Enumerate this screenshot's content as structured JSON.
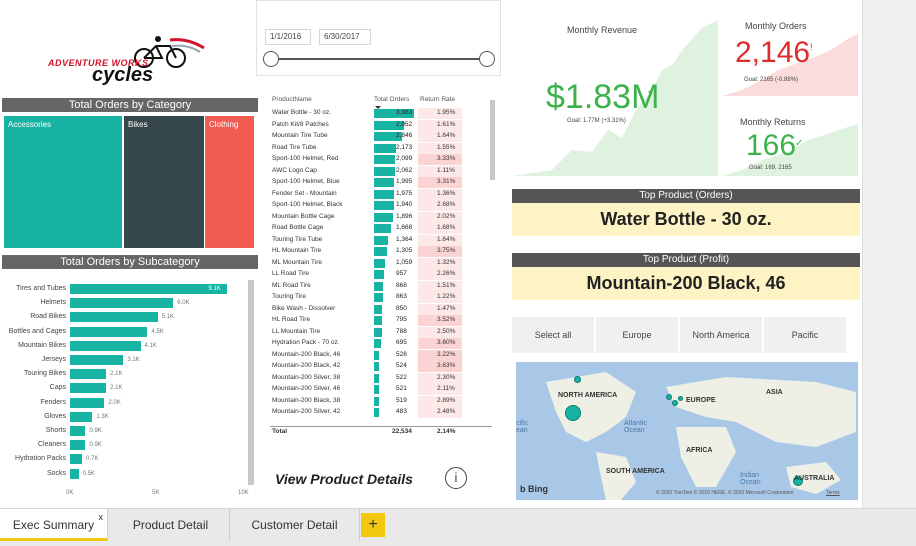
{
  "logo": {
    "line1": "ADVENTURE WORKS",
    "line2": "cycles"
  },
  "date_slicer": {
    "start": "1/1/2016",
    "end": "6/30/2017"
  },
  "category_chart": {
    "title": "Total Orders by Category",
    "tiles": [
      {
        "label": "Accessories",
        "color": "#17b3a3"
      },
      {
        "label": "Bikes",
        "color": "#36474b"
      },
      {
        "label": "Clothing",
        "color": "#f15b52"
      }
    ]
  },
  "chart_data": {
    "type": "bar",
    "title": "Total Orders by Subcategory",
    "categories": [
      "Tires and Tubes",
      "Helmets",
      "Road Bikes",
      "Bottles and Cages",
      "Mountain Bikes",
      "Jerseys",
      "Touring Bikes",
      "Caps",
      "Fenders",
      "Gloves",
      "Shorts",
      "Cleaners",
      "Hydration Packs",
      "Socks"
    ],
    "values": [
      9.1,
      6.0,
      5.1,
      4.5,
      4.1,
      3.1,
      2.1,
      2.1,
      2.0,
      1.3,
      0.9,
      0.9,
      0.7,
      0.5
    ],
    "value_labels": [
      "9.1K",
      "6.0K",
      "5.1K",
      "4.5K",
      "4.1K",
      "3.1K",
      "2.1K",
      "2.1K",
      "2.0K",
      "1.3K",
      "0.9K",
      "0.9K",
      "0.7K",
      "0.5K"
    ],
    "xlim": [
      0,
      10
    ],
    "xticks": [
      "0K",
      "5K",
      "10K"
    ],
    "color": "#17b3a3"
  },
  "product_table": {
    "headers": [
      "ProductName",
      "Total Orders",
      "Return Rate"
    ],
    "rows": [
      [
        "Water Bottle - 30 oz.",
        "3,983",
        "1.95%"
      ],
      [
        "Patch Kit/8 Patches",
        "2,952",
        "1.61%"
      ],
      [
        "Mountain Tire Tube",
        "2,846",
        "1.64%"
      ],
      [
        "Road Tire Tube",
        "2,173",
        "1.55%"
      ],
      [
        "Sport-100 Helmet, Red",
        "2,099",
        "3.33%"
      ],
      [
        "AWC Logo Cap",
        "2,062",
        "1.11%"
      ],
      [
        "Sport-100 Helmet, Blue",
        "1,995",
        "3.31%"
      ],
      [
        "Fender Set - Mountain",
        "1,975",
        "1.36%"
      ],
      [
        "Sport-100 Helmet, Black",
        "1,940",
        "2.68%"
      ],
      [
        "Mountain Bottle Cage",
        "1,896",
        "2.02%"
      ],
      [
        "Road Bottle Cage",
        "1,668",
        "1.68%"
      ],
      [
        "Touring Tire Tube",
        "1,364",
        "1.64%"
      ],
      [
        "HL Mountain Tire",
        "1,305",
        "3.75%"
      ],
      [
        "ML Mountain Tire",
        "1,059",
        "1.32%"
      ],
      [
        "LL Road Tire",
        "957",
        "2.26%"
      ],
      [
        "ML Road Tire",
        "868",
        "1.51%"
      ],
      [
        "Touring Tire",
        "863",
        "1.22%"
      ],
      [
        "Bike Wash - Dissolver",
        "850",
        "1.47%"
      ],
      [
        "HL Road Tire",
        "795",
        "3.52%"
      ],
      [
        "LL Mountain Tire",
        "788",
        "2.50%"
      ],
      [
        "Hydration Pack - 70 oz.",
        "695",
        "3.60%"
      ],
      [
        "Mountain-200 Black, 46",
        "528",
        "3.22%"
      ],
      [
        "Mountain-200 Black, 42",
        "524",
        "3.63%"
      ],
      [
        "Mountain-200 Silver, 38",
        "522",
        "2.30%"
      ],
      [
        "Mountain-200 Silver, 46",
        "521",
        "2.11%"
      ],
      [
        "Mountain-200 Black, 38",
        "519",
        "2.89%"
      ],
      [
        "Mountain-200 Silver, 42",
        "483",
        "2.48%"
      ]
    ],
    "bar_fractions": [
      1.0,
      0.74,
      0.71,
      0.55,
      0.53,
      0.52,
      0.5,
      0.5,
      0.49,
      0.48,
      0.42,
      0.34,
      0.33,
      0.27,
      0.24,
      0.22,
      0.22,
      0.21,
      0.2,
      0.2,
      0.17,
      0.13,
      0.13,
      0.13,
      0.13,
      0.13,
      0.12
    ],
    "total_label": "Total",
    "total_orders": "22,534",
    "total_rate": "2.14%"
  },
  "details_link": "View Product Details",
  "kpis": {
    "revenue": {
      "label": "Monthly Revenue",
      "value": "$1.83M",
      "goal": "Goal: 1.77M (+3.31%)"
    },
    "orders": {
      "label": "Monthly Orders",
      "value": "2,146",
      "goal": "Goal: 2165 (-0.88%)"
    },
    "returns": {
      "label": "Monthly Returns",
      "value": "166",
      "goal": "Goal: 169, 2165"
    }
  },
  "top_orders": {
    "title": "Top Product (Orders)",
    "value": "Water Bottle - 30 oz."
  },
  "top_profit": {
    "title": "Top Product (Profit)",
    "value": "Mountain-200 Black, 46"
  },
  "regions": [
    "Select all",
    "Europe",
    "North America",
    "Pacific"
  ],
  "map": {
    "labels": {
      "na": "NORTH AMERICA",
      "eu": "EUROPE",
      "asia": "ASIA",
      "africa": "AFRICA",
      "sa": "SOUTH AMERICA",
      "au": "AUSTRALIA"
    },
    "oceans": {
      "atlantic": "Atlantic Ocean",
      "indian": "Indian Ocean",
      "pacific": "cific ean"
    },
    "bing": "Bing",
    "copyright": "© 2020 TomTom © 2020 HERE, © 2020 Microsoft Corporation",
    "terms": "Terms"
  },
  "tabs": [
    {
      "label": "Exec Summary",
      "close": "x"
    },
    {
      "label": "Product Detail"
    },
    {
      "label": "Customer Detail"
    }
  ],
  "add_tab": "+",
  "colors": {
    "teal": "#17b3a3",
    "green": "#3cb34a",
    "red": "#e02b2b",
    "gold": "#f2c811"
  }
}
